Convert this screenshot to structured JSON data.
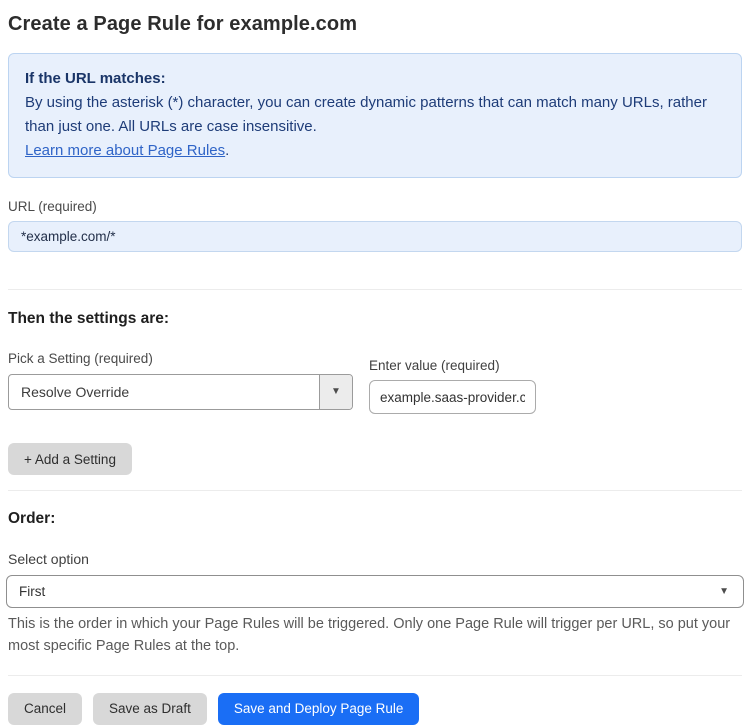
{
  "page": {
    "title": "Create a Page Rule for example.com"
  },
  "info_box": {
    "heading": "If the URL matches:",
    "body": "By using the asterisk (*) character, you can create dynamic patterns that can match many URLs, rather than just one. All URLs are case insensitive.",
    "link_text": "Learn more about Page Rules",
    "link_suffix": "."
  },
  "url_field": {
    "label": "URL (required)",
    "value": "*example.com/*"
  },
  "settings_section": {
    "heading": "Then the settings are:",
    "setting_select": {
      "label": "Pick a Setting (required)",
      "selected_value": "Resolve Override"
    },
    "value_field": {
      "label": "Enter value (required)",
      "value": "example.saas-provider.c"
    },
    "add_button_label": "+ Add a Setting"
  },
  "order_section": {
    "heading": "Order:",
    "select_label": "Select option",
    "selected_value": "First",
    "help_text": "This is the order in which your Page Rules will be triggered. Only one Page Rule will trigger per URL, so put your most specific Page Rules at the top."
  },
  "actions": {
    "cancel_label": "Cancel",
    "save_draft_label": "Save as Draft",
    "save_deploy_label": "Save and Deploy Page Rule"
  },
  "icons": {
    "dropdown_arrow": "▼"
  },
  "colors": {
    "primary_blue": "#1a6ef5",
    "info_box_bg": "#e8f0fc",
    "info_box_border": "#bcd4f1",
    "info_text": "#1e3c78",
    "link_blue": "#2f64c7",
    "url_input_bg": "#e8f0fc",
    "gray_button_bg": "#d8d8d8"
  }
}
